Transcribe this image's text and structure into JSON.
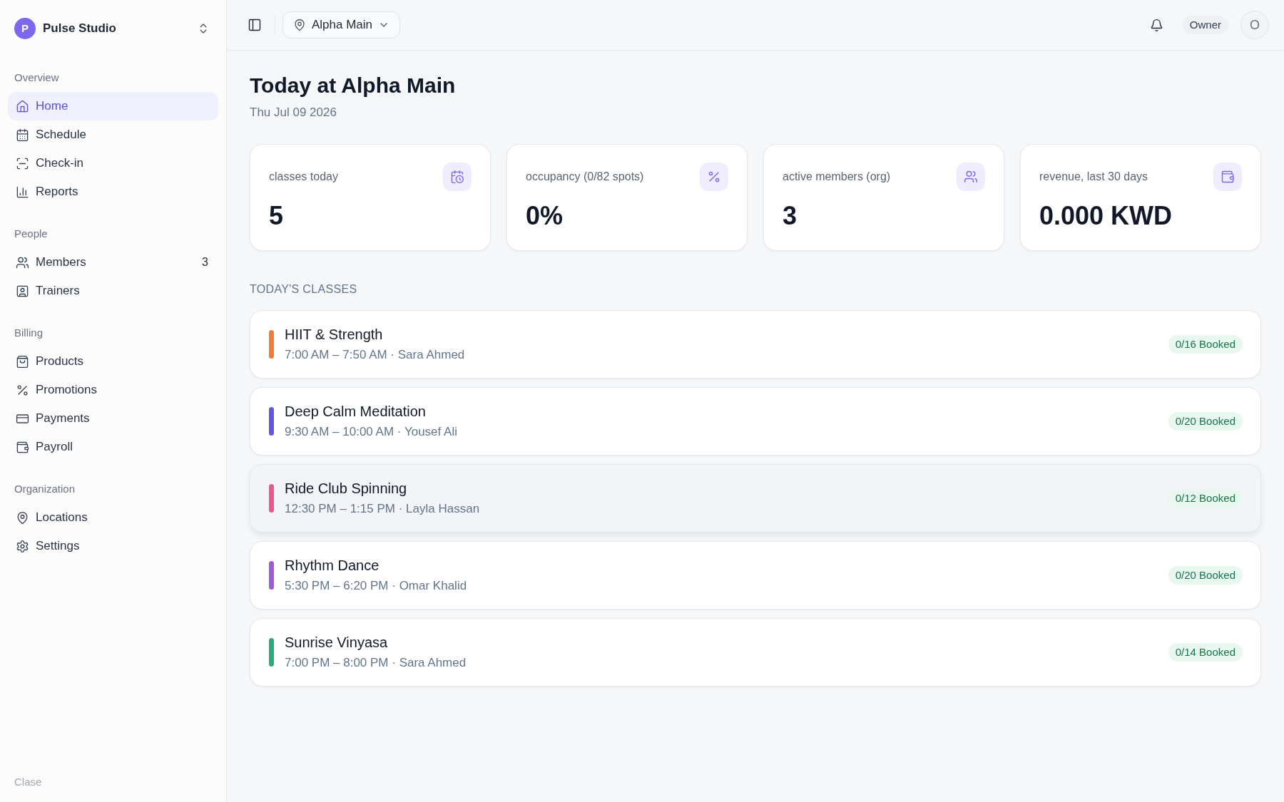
{
  "sidebar": {
    "brand": {
      "initial": "P",
      "name": "Pulse Studio"
    },
    "sections": [
      {
        "heading": "Overview",
        "items": [
          {
            "label": "Home",
            "selected": true
          },
          {
            "label": "Schedule",
            "selected": false
          },
          {
            "label": "Check-in",
            "selected": false
          },
          {
            "label": "Reports",
            "selected": false
          }
        ]
      },
      {
        "heading": "People",
        "items": [
          {
            "label": "Members",
            "count": "3",
            "selected": false
          },
          {
            "label": "Trainers",
            "selected": false
          }
        ]
      },
      {
        "heading": "Billing",
        "items": [
          {
            "label": "Products",
            "selected": false
          },
          {
            "label": "Promotions",
            "selected": false
          },
          {
            "label": "Payments",
            "selected": false
          },
          {
            "label": "Payroll",
            "selected": false
          }
        ]
      },
      {
        "heading": "Organization",
        "items": [
          {
            "label": "Locations",
            "selected": false
          },
          {
            "label": "Settings",
            "selected": false
          }
        ]
      }
    ],
    "footer": "Clase"
  },
  "topbar": {
    "location": "Alpha Main",
    "role": "Owner",
    "avatar_initial": "O"
  },
  "page": {
    "title": "Today at Alpha Main",
    "date": "Thu Jul 09 2026"
  },
  "stats": [
    {
      "label": "classes today",
      "value": "5"
    },
    {
      "label": "occupancy (0/82 spots)",
      "value": "0%"
    },
    {
      "label": "active members (org)",
      "value": "3"
    },
    {
      "label": "revenue, last 30 days",
      "value": "0.000 KWD"
    }
  ],
  "classes": {
    "heading": "TODAY'S CLASSES",
    "items": [
      {
        "name": "HIIT & Strength",
        "details": "7:00 AM – 7:50 AM · Sara Ahmed",
        "color": "#f07c3a",
        "booked": "0/16 Booked",
        "highlighted": false
      },
      {
        "name": "Deep Calm Meditation",
        "details": "9:30 AM – 10:00 AM · Yousef Ali",
        "color": "#6356e0",
        "booked": "0/20 Booked",
        "highlighted": false
      },
      {
        "name": "Ride Club Spinning",
        "details": "12:30 PM – 1:15 PM · Layla Hassan",
        "color": "#e6588f",
        "booked": "0/12 Booked",
        "highlighted": true
      },
      {
        "name": "Rhythm Dance",
        "details": "5:30 PM – 6:20 PM · Omar Khalid",
        "color": "#a05ad6",
        "booked": "0/20 Booked",
        "highlighted": false
      },
      {
        "name": "Sunrise Vinyasa",
        "details": "7:00 PM – 8:00 PM · Sara Ahmed",
        "color": "#2eaa78",
        "booked": "0/14 Booked",
        "highlighted": false
      }
    ]
  }
}
